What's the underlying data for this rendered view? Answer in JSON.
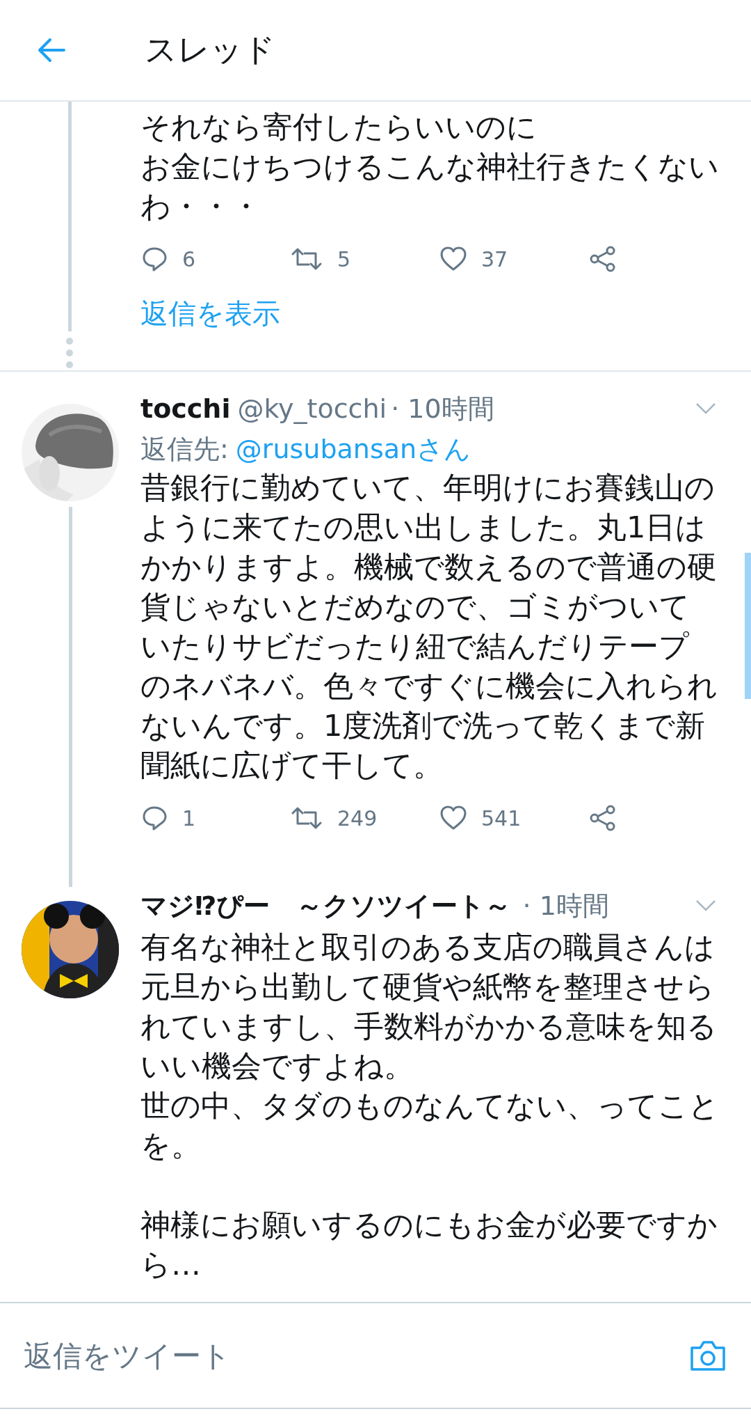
{
  "header": {
    "title": "スレッド"
  },
  "tweets": [
    {
      "kind": "continuation",
      "paragraphs": [
        [
          "それなら寄付したらいいのに",
          "お金にけちつけるこんな神社行きたくないわ・・・"
        ]
      ],
      "actions": {
        "replies": "6",
        "retweets": "5",
        "likes": "37"
      },
      "show_replies": "返信を表示"
    },
    {
      "kind": "full",
      "name": "tocchi",
      "handle": "@ky_tocchi",
      "time": "· 10時間",
      "reply_label": "返信先:",
      "reply_to": "@rusubansanさん",
      "paragraphs": [
        [
          "昔銀行に勤めていて、年明けにお賽銭山のように来てたの思い出しました。丸1日はかかりますよ。機械で数えるので普通の硬貨じゃないとだめなので、ゴミがついていたりサビだったり紐で結んだりテープのネバネバ。色々ですぐに機会に入れられないんです。1度洗剤で洗って乾くまで新聞紙に広げて干して。"
        ]
      ],
      "actions": {
        "replies": "1",
        "retweets": "249",
        "likes": "541"
      }
    },
    {
      "kind": "full",
      "name": "マジ⁉ぴー　～クソツイート～",
      "time": "· 1時間",
      "paragraphs": [
        [
          "有名な神社と取引のある支店の職員さんは元旦から出勤して硬貨や紙幣を整理させられていますし、手数料がかかる意味を知るいい機会ですよね。",
          "世の中、タダのものなんてない、ってことを。"
        ],
        [
          "神様にお願いするのにもお金が必要ですから…"
        ]
      ]
    }
  ],
  "composer": {
    "placeholder": "返信をツイート"
  }
}
